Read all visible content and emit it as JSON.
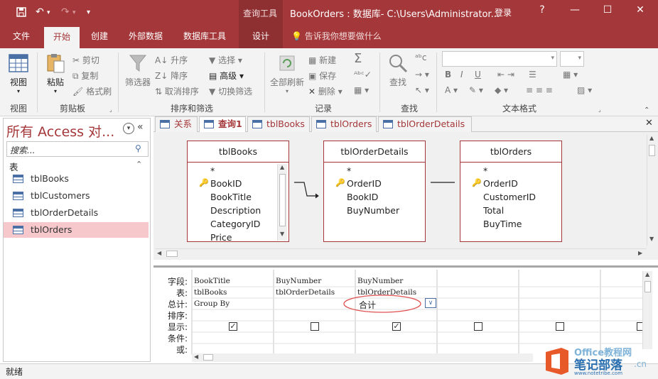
{
  "titlebar": {
    "context_tab": "查询工具",
    "window_title": "BookOrders : 数据库- C:\\Users\\Administrator...",
    "login": "登录",
    "help": "?",
    "minimize": "—",
    "maximize": "☐",
    "close": "✕"
  },
  "tabs": [
    "文件",
    "开始",
    "创建",
    "外部数据",
    "数据库工具",
    "设计"
  ],
  "tell_me": "告诉我你想要做什么",
  "ribbon": {
    "view_group": {
      "button": "视图",
      "label": "视图"
    },
    "clipboard": {
      "paste": "粘贴",
      "cut": "剪切",
      "copy": "复制",
      "format_painter": "格式刷",
      "label": "剪贴板"
    },
    "sort_filter": {
      "filter": "筛选器",
      "asc": "升序",
      "desc": "降序",
      "clear_sort": "取消排序",
      "selection": "选择",
      "advanced": "高级",
      "toggle_filter": "切换筛选",
      "label": "排序和筛选"
    },
    "records": {
      "refresh_all": "全部刷新",
      "new": "新建",
      "save": "保存",
      "delete": "删除",
      "label": "记录"
    },
    "find": {
      "find": "查找",
      "label": "查找"
    },
    "text_format": {
      "label": "文本格式"
    }
  },
  "nav": {
    "title": "所有 Access 对...",
    "search_placeholder": "搜索...",
    "section": "表",
    "items": [
      "tblBooks",
      "tblCustomers",
      "tblOrderDetails",
      "tblOrders"
    ]
  },
  "doc_tabs": [
    "关系",
    "查询1",
    "tblBooks",
    "tblOrders",
    "tblOrderDetails"
  ],
  "tables": [
    {
      "name": "tblBooks",
      "fields": [
        "*",
        "BookID",
        "BookTitle",
        "Description",
        "CategoryID",
        "Price"
      ]
    },
    {
      "name": "tblOrderDetails",
      "fields": [
        "*",
        "OrderID",
        "BookID",
        "BuyNumber"
      ]
    },
    {
      "name": "tblOrders",
      "fields": [
        "*",
        "OrderID",
        "CustomerID",
        "Total",
        "BuyTime"
      ]
    }
  ],
  "grid": {
    "row_labels": [
      "字段:",
      "表:",
      "总计:",
      "排序:",
      "显示:",
      "条件:",
      "或:"
    ],
    "columns": [
      {
        "field": "BookTitle",
        "table": "tblBooks",
        "total": "Group By",
        "show": true
      },
      {
        "field": "BuyNumber",
        "table": "tblOrderDetails",
        "total": "",
        "show": false
      },
      {
        "field": "BuyNumber",
        "table": "tblOrderDetails",
        "total": "合计",
        "show": true
      },
      {
        "field": "",
        "table": "",
        "total": "",
        "show": false
      },
      {
        "field": "",
        "table": "",
        "total": "",
        "show": false
      },
      {
        "field": "",
        "table": "",
        "total": "",
        "show": false
      }
    ]
  },
  "status": "就绪",
  "watermark": {
    "line1": "Office教程网",
    "line2": "笔记部落",
    "line3": "www.notetribe.com",
    "suffix": ".cn"
  },
  "colors": {
    "brand": "#a4373a",
    "selection": "#f6c7cb",
    "annotation": "#e05050"
  }
}
